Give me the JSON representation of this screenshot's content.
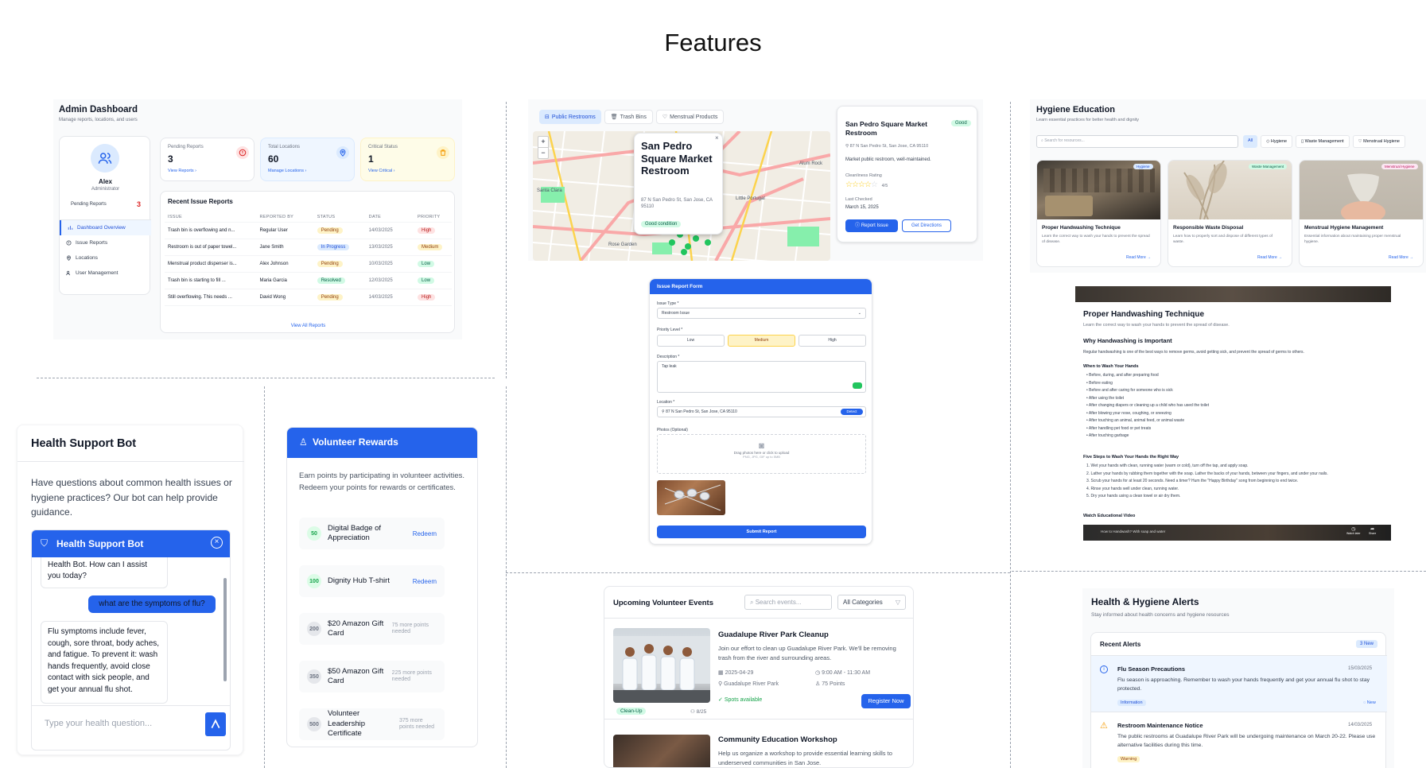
{
  "page": {
    "title": "Features"
  },
  "colors": {
    "primary": "#2563eb",
    "danger": "#dc2626",
    "success": "#16a34a",
    "warning": "#f59e0b"
  },
  "admin": {
    "title": "Admin Dashboard",
    "subtitle": "Manage reports, locations, and users",
    "user": {
      "name": "Alex",
      "role": "Administrator",
      "pending_label": "Pending Reports",
      "pending_count": "3"
    },
    "nav": [
      {
        "label": "Dashboard Overview",
        "icon": "chart-icon"
      },
      {
        "label": "Issue Reports",
        "icon": "alert-icon"
      },
      {
        "label": "Locations",
        "icon": "pin-icon"
      },
      {
        "label": "User Management",
        "icon": "users-icon"
      }
    ],
    "stats": [
      {
        "label": "Pending Reports",
        "value": "3",
        "link": "View Reports ›"
      },
      {
        "label": "Total Locations",
        "value": "60",
        "link": "Manage Locations ›"
      },
      {
        "label": "Critical Status",
        "value": "1",
        "link": "View Critical ›"
      }
    ],
    "recent": {
      "title": "Recent Issue Reports",
      "columns": [
        "ISSUE",
        "REPORTED BY",
        "STATUS",
        "DATE",
        "PRIORITY"
      ],
      "rows": [
        {
          "issue": "Trash bin is overflowing and n...",
          "by": "Regular User",
          "status": "Pending",
          "date": "14/03/2025",
          "priority": "High"
        },
        {
          "issue": "Restroom is out of paper towel...",
          "by": "Jane Smith",
          "status": "In Progress",
          "date": "13/03/2025",
          "priority": "Medium"
        },
        {
          "issue": "Menstrual product dispenser is...",
          "by": "Alex Johnson",
          "status": "Pending",
          "date": "10/03/2025",
          "priority": "Low"
        },
        {
          "issue": "Trash bin is starting to fill ...",
          "by": "Maria Garcia",
          "status": "Resolved",
          "date": "12/03/2025",
          "priority": "Low"
        },
        {
          "issue": "Still overflowing. This needs ...",
          "by": "David Wong",
          "status": "Pending",
          "date": "14/03/2025",
          "priority": "High"
        }
      ],
      "view_all": "View All Reports"
    }
  },
  "map": {
    "tabs": [
      "Public Restrooms",
      "Trash Bins",
      "Menstrual Products"
    ],
    "zoom_in": "+",
    "zoom_out": "−",
    "labels": [
      "Santa Clara",
      "Rose Garden",
      "Little Portugal",
      "Alum Rock"
    ],
    "popup": {
      "title": "San Pedro Square Market Restroom",
      "address": "87 N San Pedro St, San Jose, CA 95110",
      "badge": "Good condition",
      "close": "×"
    },
    "detail": {
      "title": "San Pedro Square Market Restroom",
      "badge": "Good",
      "address": "87 N San Pedro St, San Jose, CA 95110",
      "desc": "Market public restroom, well-maintained.",
      "rating_label": "Cleanliness Rating",
      "rating": 4,
      "rating_text": "4/5",
      "checked_label": "Last Checked",
      "checked": "March 15, 2025",
      "btn_report": "Report Issue",
      "btn_directions": "Get Directions"
    }
  },
  "form": {
    "title": "Issue Report Form",
    "type_label": "Issue Type *",
    "type_value": "Restroom Issue",
    "priority_label": "Priority Level *",
    "priorities": [
      "Low",
      "Medium",
      "High"
    ],
    "desc_label": "Description *",
    "desc_value": "Tap leak",
    "location_label": "Location *",
    "location_value": "87 N San Pedro St, San Jose, CA 95110",
    "detect": "Detect",
    "photos_label": "Photos (Optional)",
    "drop_text": "Drag photos here or click to upload",
    "drop_sub": "PNG, JPG, GIF up to 5MB",
    "submit": "Submit Report"
  },
  "edu": {
    "title": "Hygiene Education",
    "subtitle": "Learn essential practices for better health and dignity",
    "search_placeholder": "Search for resources...",
    "filters": [
      "All",
      "Hygiene",
      "Waste Management",
      "Menstrual Hygiene"
    ],
    "cards": [
      {
        "badge": "Hygiene",
        "title": "Proper Handwashing Technique",
        "desc": "Learn the correct way to wash your hands to prevent the spread of disease.",
        "link": "Read More →"
      },
      {
        "badge": "Waste Management",
        "title": "Responsible Waste Disposal",
        "desc": "Learn how to properly sort and dispose of different types of waste.",
        "link": "Read More →"
      },
      {
        "badge": "Menstrual Hygiene",
        "title": "Menstrual Hygiene Management",
        "desc": "Essential information about maintaining proper menstrual hygiene.",
        "link": "Read More →"
      }
    ]
  },
  "article": {
    "title": "Proper Handwashing Technique",
    "intro": "Learn the correct way to wash your hands to prevent the spread of disease.",
    "h_why": "Why Handwashing is Important",
    "why_text": "Regular handwashing is one of the best ways to remove germs, avoid getting sick, and prevent the spread of germs to others.",
    "h_when": "When to Wash Your Hands",
    "when": [
      "Before, during, and after preparing food",
      "Before eating",
      "Before and after caring for someone who is sick",
      "After using the toilet",
      "After changing diapers or cleaning up a child who has used the toilet",
      "After blowing your nose, coughing, or sneezing",
      "After touching an animal, animal feed, or animal waste",
      "After handling pet food or pet treats",
      "After touching garbage"
    ],
    "h_steps": "Five Steps to Wash Your Hands the Right Way",
    "steps": [
      "1. Wet your hands with clean, running water (warm or cold), turn off the tap, and apply soap.",
      "2. Lather your hands by rubbing them together with the soap. Lather the backs of your hands, between your fingers, and under your nails.",
      "3. Scrub your hands for at least 20 seconds. Need a timer? Hum the \"Happy Birthday\" song from beginning to end twice.",
      "4. Rinse your hands well under clean, running water.",
      "5. Dry your hands using a clean towel or air dry them."
    ],
    "h_video": "Watch Educational Video",
    "video_title": "How to Handwash? With soap and water",
    "video_actions": [
      "Watch later",
      "Share"
    ]
  },
  "bot": {
    "heading": "Health Support Bot",
    "intro": "Have questions about common health issues or hygiene practices? Our bot can help provide guidance.",
    "header": "Health Support Bot",
    "msg_bot1": "Health Bot. How can I assist you today?",
    "msg_user": "what are the symptoms of flu?",
    "msg_bot2": "Flu symptoms include fever, cough, sore throat, body aches, and fatigue. To prevent it: wash hands frequently, avoid close contact with sick people, and get your annual flu shot.",
    "placeholder": "Type your health question..."
  },
  "rewards": {
    "title": "Volunteer Rewards",
    "intro": "Earn points by participating in volunteer activities. Redeem your points for rewards or certificates.",
    "items": [
      {
        "points": "50",
        "name": "Digital Badge of Appreciation",
        "action": "Redeem"
      },
      {
        "points": "100",
        "name": "Dignity Hub T-shirt",
        "action": "Redeem"
      },
      {
        "points": "200",
        "name": "$20 Amazon Gift Card",
        "need": "75 more points needed"
      },
      {
        "points": "350",
        "name": "$50 Amazon Gift Card",
        "need": "225 more points needed"
      },
      {
        "points": "500",
        "name": "Volunteer Leadership Certificate",
        "need": "375 more points needed"
      }
    ]
  },
  "events": {
    "title": "Upcoming Volunteer Events",
    "search_placeholder": "Search events...",
    "category": "All Categories",
    "items": [
      {
        "title": "Guadalupe River Park Cleanup",
        "desc": "Join our effort to clean up Guadalupe River Park. We'll be removing trash from the river and surrounding areas.",
        "date": "2025-04-29",
        "time": "9:00 AM - 11:30 AM",
        "place": "Guadalupe River Park",
        "points": "75 Points",
        "tag": "Clean-Up",
        "count": "8/25",
        "spots": "Spots available",
        "btn": "Register Now"
      },
      {
        "title": "Community Education Workshop",
        "desc": "Help us organize a workshop to provide essential learning skills to underserved communities in San Jose."
      }
    ]
  },
  "alerts": {
    "title": "Health & Hygiene Alerts",
    "subtitle": "Stay informed about health concerns and hygiene resources",
    "recent_label": "Recent Alerts",
    "new_badge": "3 New",
    "items": [
      {
        "title": "Flu Season Precautions",
        "date": "15/03/2025",
        "text": "Flu season is approaching. Remember to wash your hands frequently and get your annual flu shot to stay protected.",
        "tag": "Information",
        "new": "New"
      },
      {
        "title": "Restroom Maintenance Notice",
        "date": "14/03/2025",
        "text": "The public restrooms at Guadalupe River Park will be undergoing maintenance on March 20-22. Please use alternative facilities during this time.",
        "tag": "Warning"
      }
    ]
  }
}
